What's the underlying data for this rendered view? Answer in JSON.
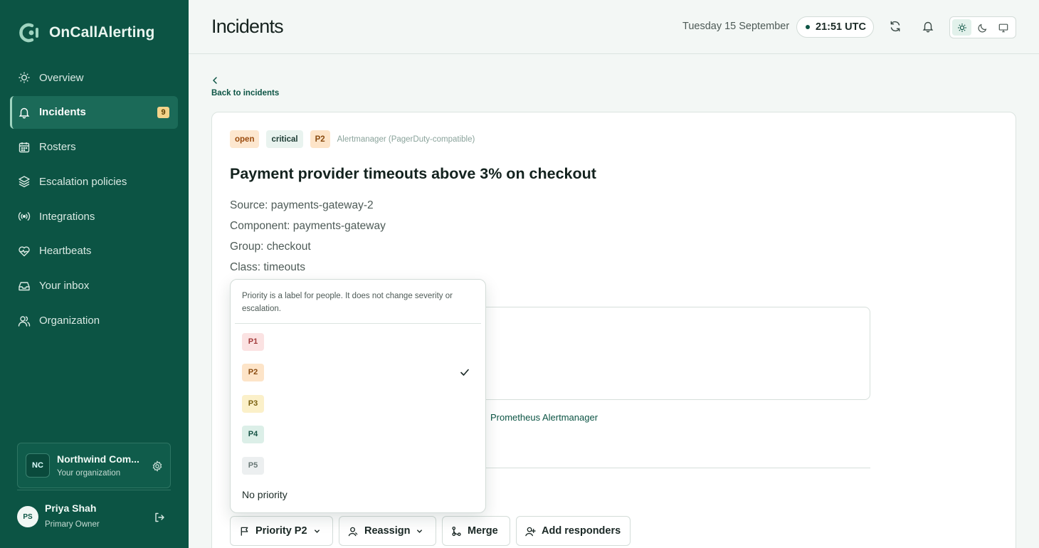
{
  "app": {
    "name": "OnCallAlerting"
  },
  "sidebar": {
    "items": [
      {
        "label": "Overview",
        "icon": "sun-icon"
      },
      {
        "label": "Incidents",
        "icon": "bell-icon",
        "badge": "9",
        "active": true
      },
      {
        "label": "Rosters",
        "icon": "calendar-icon"
      },
      {
        "label": "Escalation policies",
        "icon": "layers-icon"
      },
      {
        "label": "Integrations",
        "icon": "broadcast-icon"
      },
      {
        "label": "Heartbeats",
        "icon": "heart-pulse-icon"
      },
      {
        "label": "Your inbox",
        "icon": "inbox-icon"
      },
      {
        "label": "Organization",
        "icon": "users-icon"
      }
    ],
    "org": {
      "initials": "NC",
      "name": "Northwind Com...",
      "sub": "Your organization"
    },
    "user": {
      "initials": "PS",
      "name": "Priya Shah",
      "role": "Primary Owner"
    }
  },
  "header": {
    "title": "Incidents",
    "date": "Tuesday 15 September",
    "time": "21:51 UTC"
  },
  "back": {
    "label": "Back to incidents"
  },
  "incident": {
    "status": "open",
    "severity": "critical",
    "priority": "P2",
    "source_label": "Alertmanager (PagerDuty-compatible)",
    "title": "Payment provider timeouts above 3% on checkout",
    "source": "Source: payments-gateway-2",
    "component": "Component: payments-gateway",
    "group": "Group: checkout",
    "class": "Class: timeouts",
    "integration_link": "Prometheus Alertmanager"
  },
  "priority_menu": {
    "note": "Priority is a label for people. It does not change severity or escalation.",
    "options": [
      "P1",
      "P2",
      "P3",
      "P4",
      "P5"
    ],
    "selected": "P2",
    "none_label": "No priority"
  },
  "actions": {
    "priority": "Priority P2",
    "reassign": "Reassign",
    "merge": "Merge",
    "add_responders": "Add responders"
  },
  "colors": {
    "sidebar": "#0c5444",
    "accent": "#0c5444"
  }
}
